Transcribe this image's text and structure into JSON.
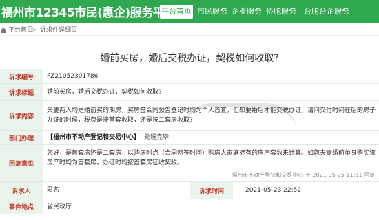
{
  "header": {
    "logo_text": "福州市12345市民(惠企)服务平台",
    "nav": [
      {
        "label": "平台首页",
        "active": true
      },
      {
        "label": "市民服务",
        "active": false
      },
      {
        "label": "企业服务",
        "active": false
      },
      {
        "label": "侨胞服务",
        "active": false
      },
      {
        "label": "台胞台企服务",
        "active": false
      }
    ],
    "accent_color": "#2fa84f"
  },
  "breadcrumb": {
    "home": "平台首页",
    "separator": ">",
    "current": "诉求件详细页"
  },
  "page_title": "婚前买房，婚后交税办证，契税如何收取?",
  "details": {
    "number_label": "诉求编号",
    "number_value": "FZ21052301786",
    "subject_label": "诉求标题",
    "subject_value": "婚前买房，婚后交税办证，契税如何收取?",
    "content_label": "诉求内容",
    "content_value": "夫妻两人均是婚前买的期房，买房签合同预告登记时均为个人首套，但都要婚后才能交税办证，请问交付时间在后的房子办证的时候，税费是按首套收取，还是按二套房收取?",
    "dept_label": "部门办理",
    "dept_name": "【福州市不动产登记和交易中心】",
    "dept_status": "处理完毕",
    "reply_label": "回复意见",
    "reply_value": "您好，是首套房还是二套房，以购房时点（合同网签时间）购房人家庭拥有的房产套数来计算。如您夫妻婚前单身购买该房产时均为首套房，办证时均按首套房征收契税。",
    "reply_footer": "福州市不动产登记和交易中心 于 2021-05-25 11:31 回复",
    "appellant_label": "诉求人",
    "appellant_value": "匿名",
    "time_label": "诉求时间",
    "time_value": "2021-05-23 22:52",
    "place_label": "事件地点",
    "place_value": "省民政厅"
  },
  "watermark": "海西房产网"
}
